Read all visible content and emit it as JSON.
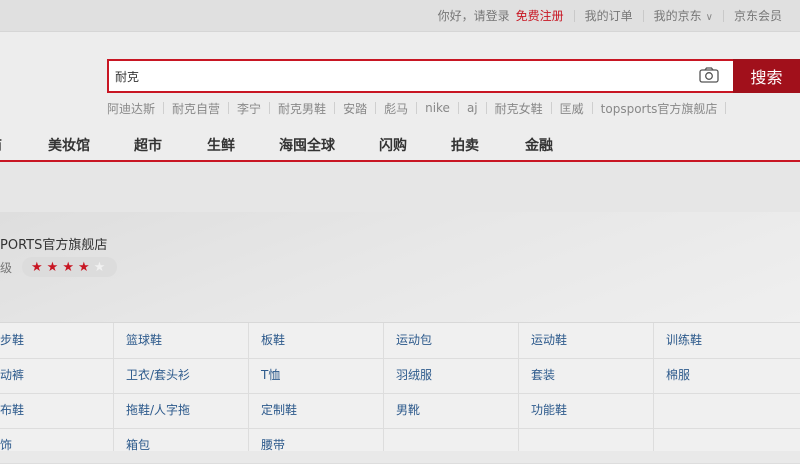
{
  "topbar": {
    "greeting": "你好，请登录",
    "register": "免费注册",
    "my_orders": "我的订单",
    "my_jd": "我的京东",
    "jd_member": "京东会员"
  },
  "search": {
    "value": "耐克",
    "button_label": "搜索"
  },
  "hot_words": [
    "阿迪达斯",
    "耐克自营",
    "李宁",
    "耐克男鞋",
    "安踏",
    "彪马",
    "nike",
    "aj",
    "耐克女鞋",
    "匡威",
    "topsports官方旗舰店"
  ],
  "nav": [
    "商",
    "美妆馆",
    "超市",
    "生鲜",
    "海囤全球",
    "闪购",
    "拍卖",
    "金融"
  ],
  "shop": {
    "name": "PORTS官方旗舰店",
    "level_label": "级",
    "rating": 4,
    "rating_max": 5
  },
  "categories": [
    [
      "跑步鞋",
      "篮球鞋",
      "板鞋",
      "运动包",
      "运动鞋",
      "训练鞋"
    ],
    [
      "运动裤",
      "卫衣/套头衫",
      "T恤",
      "羽绒服",
      "套装",
      "棉服"
    ],
    [
      "帆布鞋",
      "拖鞋/人字拖",
      "定制鞋",
      "男靴",
      "功能鞋",
      ""
    ],
    [
      "服饰",
      "箱包",
      "腰带",
      "",
      "",
      ""
    ]
  ],
  "colors": {
    "accent": "#c81623",
    "search_button": "#a1101b",
    "link": "#2d5a8c"
  }
}
